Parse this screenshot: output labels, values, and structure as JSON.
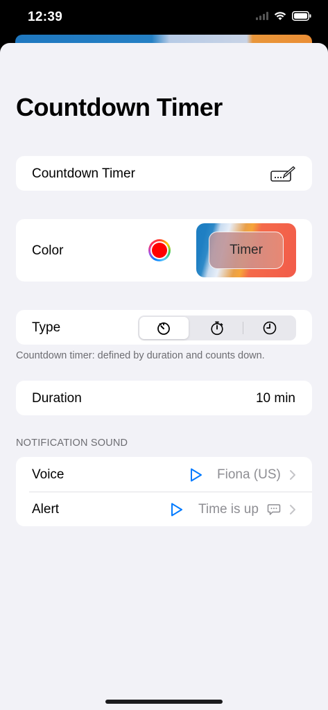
{
  "status_bar": {
    "time": "12:39"
  },
  "page": {
    "title": "Countdown Timer"
  },
  "name_row": {
    "value": "Countdown Timer",
    "edit_icon": "keyboard-edit-icon"
  },
  "color_row": {
    "label": "Color",
    "selected_color": "#ff0000",
    "preview_button_label": "Timer"
  },
  "type_row": {
    "label": "Type",
    "options": [
      "countdown-timer-icon",
      "stopwatch-icon",
      "clock-icon"
    ],
    "selected_index": 0,
    "footnote": "Countdown timer: defined by duration and counts down."
  },
  "duration_row": {
    "label": "Duration",
    "value": "10 min"
  },
  "notification_sound": {
    "header": "NOTIFICATION SOUND",
    "items": [
      {
        "label": "Voice",
        "value": "Fiona (US)"
      },
      {
        "label": "Alert",
        "value": "Time is up"
      }
    ]
  },
  "colors": {
    "accent_blue": "#007aff",
    "background": "#f2f2f7"
  }
}
